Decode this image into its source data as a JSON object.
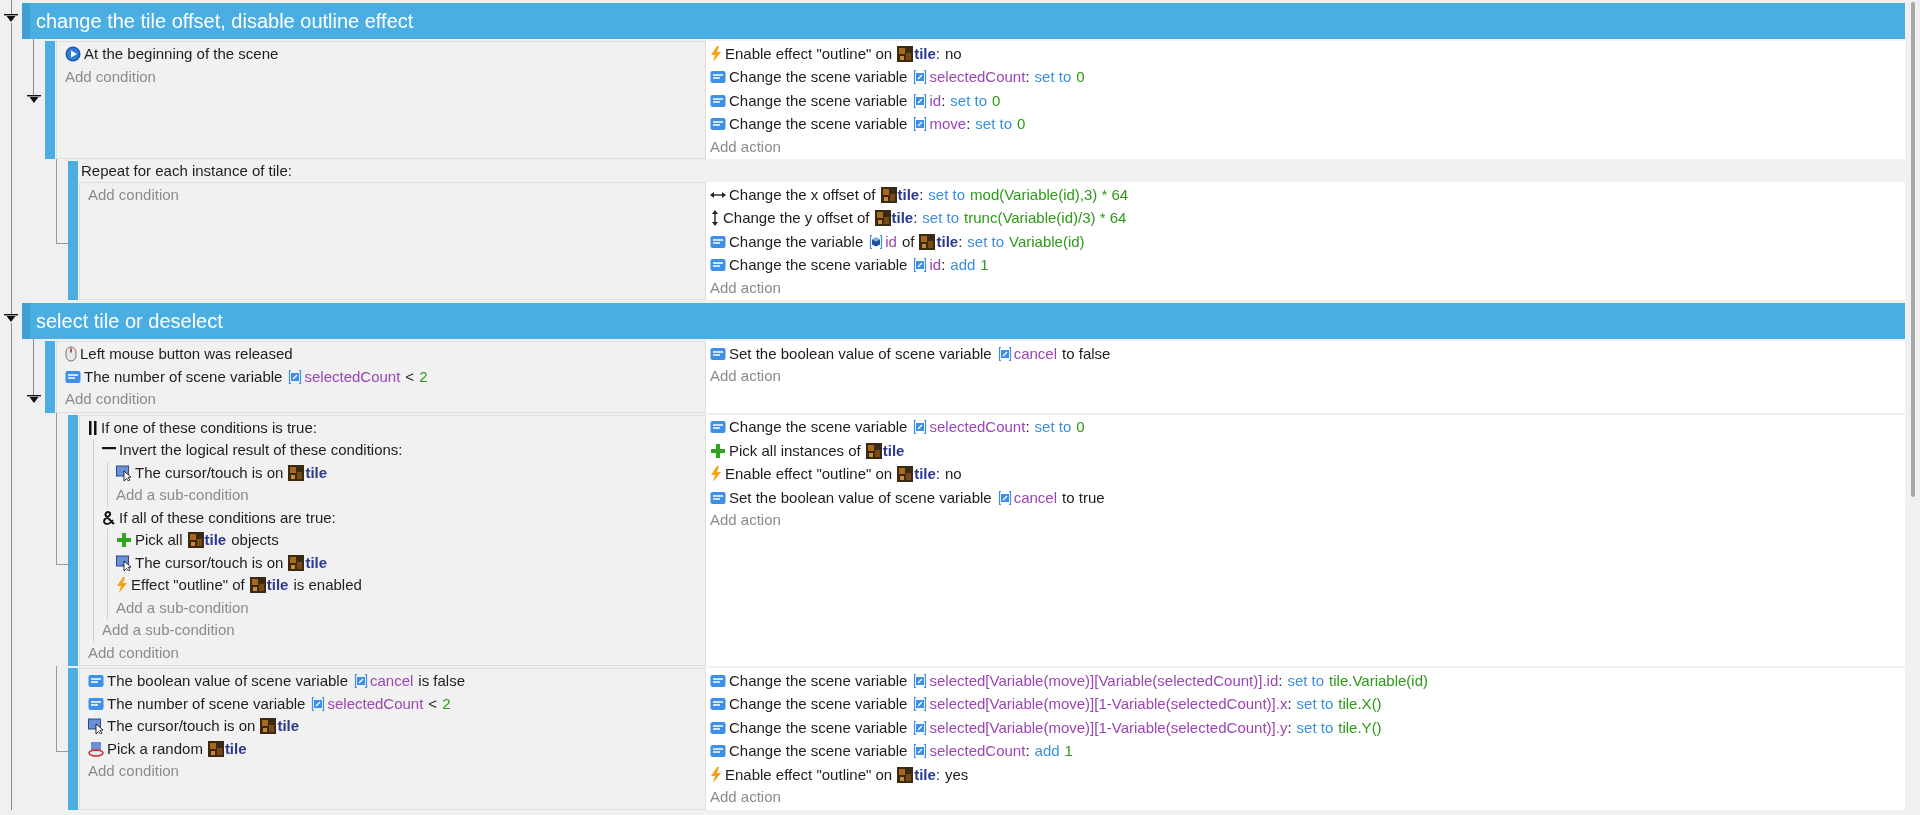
{
  "groups": [
    {
      "title": "change the tile offset, disable outline effect",
      "expanded": true,
      "events": [
        {
          "expanded": true,
          "conditions": [
            {
              "kind": "start",
              "parts": [
                {
                  "kind": "text",
                  "text": "At the beginning of the scene"
                }
              ]
            }
          ],
          "add_condition": "Add condition",
          "actions": [
            {
              "kind": "effect",
              "parts": [
                {
                  "kind": "text",
                  "text": "Enable effect \"outline\" on"
                },
                {
                  "kind": "object",
                  "text": "tile"
                },
                {
                  "kind": "punct",
                  "text": ":"
                },
                {
                  "kind": "text",
                  "text": "no"
                }
              ]
            },
            {
              "kind": "var",
              "parts": [
                {
                  "kind": "text",
                  "text": "Change the scene variable"
                },
                {
                  "kind": "scene_var",
                  "text": "selectedCount"
                },
                {
                  "kind": "punct",
                  "text": ":"
                },
                {
                  "kind": "operator",
                  "text": "set to"
                },
                {
                  "kind": "value",
                  "text": "0"
                }
              ]
            },
            {
              "kind": "var",
              "parts": [
                {
                  "kind": "text",
                  "text": "Change the scene variable"
                },
                {
                  "kind": "scene_var",
                  "text": "id"
                },
                {
                  "kind": "punct",
                  "text": ":"
                },
                {
                  "kind": "operator",
                  "text": "set to"
                },
                {
                  "kind": "value",
                  "text": "0"
                }
              ]
            },
            {
              "kind": "var",
              "parts": [
                {
                  "kind": "text",
                  "text": "Change the scene variable"
                },
                {
                  "kind": "scene_var",
                  "text": "move"
                },
                {
                  "kind": "punct",
                  "text": ":"
                },
                {
                  "kind": "operator",
                  "text": "set to"
                },
                {
                  "kind": "value",
                  "text": "0"
                }
              ]
            }
          ],
          "add_action": "Add action",
          "children": [
            {
              "header": "Repeat for each instance of tile:",
              "add_condition": "Add condition",
              "actions": [
                {
                  "kind": "offset_x",
                  "parts": [
                    {
                      "kind": "text",
                      "text": "Change the x offset of"
                    },
                    {
                      "kind": "object",
                      "text": "tile"
                    },
                    {
                      "kind": "punct",
                      "text": ":"
                    },
                    {
                      "kind": "operator",
                      "text": "set to"
                    },
                    {
                      "kind": "value",
                      "text": "mod(Variable(id),3) * 64"
                    }
                  ]
                },
                {
                  "kind": "offset_y",
                  "parts": [
                    {
                      "kind": "text",
                      "text": "Change the y offset of"
                    },
                    {
                      "kind": "object",
                      "text": "tile"
                    },
                    {
                      "kind": "punct",
                      "text": ":"
                    },
                    {
                      "kind": "operator",
                      "text": "set to"
                    },
                    {
                      "kind": "value",
                      "text": "trunc(Variable(id)/3) * 64"
                    }
                  ]
                },
                {
                  "kind": "var",
                  "parts": [
                    {
                      "kind": "text",
                      "text": "Change the variable"
                    },
                    {
                      "kind": "object_var",
                      "text": "id"
                    },
                    {
                      "kind": "text",
                      "text": "of"
                    },
                    {
                      "kind": "object",
                      "text": "tile"
                    },
                    {
                      "kind": "punct",
                      "text": ":"
                    },
                    {
                      "kind": "operator",
                      "text": "set to"
                    },
                    {
                      "kind": "value",
                      "text": "Variable(id)"
                    }
                  ]
                },
                {
                  "kind": "var",
                  "parts": [
                    {
                      "kind": "text",
                      "text": "Change the scene variable"
                    },
                    {
                      "kind": "scene_var",
                      "text": "id"
                    },
                    {
                      "kind": "punct",
                      "text": ":"
                    },
                    {
                      "kind": "operator",
                      "text": "add"
                    },
                    {
                      "kind": "value",
                      "text": "1"
                    }
                  ]
                }
              ],
              "add_action": "Add action"
            }
          ]
        }
      ]
    },
    {
      "title": "select tile or deselect",
      "expanded": true,
      "events": [
        {
          "expanded": true,
          "conditions": [
            {
              "kind": "mouse",
              "parts": [
                {
                  "kind": "text",
                  "text": "Left mouse button was released"
                }
              ]
            },
            {
              "kind": "var",
              "parts": [
                {
                  "kind": "text",
                  "text": "The number of scene variable"
                },
                {
                  "kind": "scene_var",
                  "text": "selectedCount"
                },
                {
                  "kind": "text",
                  "text": "<"
                },
                {
                  "kind": "value",
                  "text": "2"
                }
              ]
            }
          ],
          "add_condition": "Add condition",
          "actions": [
            {
              "kind": "var",
              "parts": [
                {
                  "kind": "text",
                  "text": "Set the boolean value of scene variable"
                },
                {
                  "kind": "scene_var",
                  "text": "cancel"
                },
                {
                  "kind": "text",
                  "text": "to false"
                }
              ]
            }
          ],
          "add_action": "Add action",
          "children": [
            {
              "conditions": [
                {
                  "kind": "or",
                  "parts": [
                    {
                      "kind": "text",
                      "text": "If one of these conditions is true:"
                    }
                  ],
                  "add_sub": "Add a sub-condition",
                  "children": [
                    {
                      "kind": "not",
                      "parts": [
                        {
                          "kind": "text",
                          "text": "Invert the logical result of these conditions:"
                        }
                      ],
                      "add_sub": "Add a sub-condition",
                      "children": [
                        {
                          "kind": "cursor",
                          "parts": [
                            {
                              "kind": "text",
                              "text": "The cursor/touch is on"
                            },
                            {
                              "kind": "object",
                              "text": "tile"
                            }
                          ]
                        }
                      ]
                    },
                    {
                      "kind": "and",
                      "parts": [
                        {
                          "kind": "text",
                          "text": "If all of these conditions are true:"
                        }
                      ],
                      "add_sub": "Add a sub-condition",
                      "children": [
                        {
                          "kind": "pick_all",
                          "parts": [
                            {
                              "kind": "text",
                              "text": "Pick all"
                            },
                            {
                              "kind": "object",
                              "text": "tile"
                            },
                            {
                              "kind": "text",
                              "text": "objects"
                            }
                          ]
                        },
                        {
                          "kind": "cursor",
                          "parts": [
                            {
                              "kind": "text",
                              "text": "The cursor/touch is on"
                            },
                            {
                              "kind": "object",
                              "text": "tile"
                            }
                          ]
                        },
                        {
                          "kind": "effect",
                          "parts": [
                            {
                              "kind": "text",
                              "text": "Effect \"outline\" of"
                            },
                            {
                              "kind": "object",
                              "text": "tile"
                            },
                            {
                              "kind": "text",
                              "text": "is enabled"
                            }
                          ]
                        }
                      ]
                    }
                  ]
                }
              ],
              "add_condition": "Add condition",
              "actions": [
                {
                  "kind": "var",
                  "parts": [
                    {
                      "kind": "text",
                      "text": "Change the scene variable"
                    },
                    {
                      "kind": "scene_var",
                      "text": "selectedCount"
                    },
                    {
                      "kind": "punct",
                      "text": ":"
                    },
                    {
                      "kind": "operator",
                      "text": "set to"
                    },
                    {
                      "kind": "value",
                      "text": "0"
                    }
                  ]
                },
                {
                  "kind": "pick_all",
                  "parts": [
                    {
                      "kind": "text",
                      "text": "Pick all instances of"
                    },
                    {
                      "kind": "object",
                      "text": "tile"
                    }
                  ]
                },
                {
                  "kind": "effect",
                  "parts": [
                    {
                      "kind": "text",
                      "text": "Enable effect \"outline\" on"
                    },
                    {
                      "kind": "object",
                      "text": "tile"
                    },
                    {
                      "kind": "punct",
                      "text": ":"
                    },
                    {
                      "kind": "text",
                      "text": "no"
                    }
                  ]
                },
                {
                  "kind": "var",
                  "parts": [
                    {
                      "kind": "text",
                      "text": "Set the boolean value of scene variable"
                    },
                    {
                      "kind": "scene_var",
                      "text": "cancel"
                    },
                    {
                      "kind": "text",
                      "text": "to true"
                    }
                  ]
                }
              ],
              "add_action": "Add action"
            },
            {
              "conditions": [
                {
                  "kind": "var",
                  "parts": [
                    {
                      "kind": "text",
                      "text": "The boolean value of scene variable"
                    },
                    {
                      "kind": "scene_var",
                      "text": "cancel"
                    },
                    {
                      "kind": "text",
                      "text": "is false"
                    }
                  ]
                },
                {
                  "kind": "var",
                  "parts": [
                    {
                      "kind": "text",
                      "text": "The number of scene variable"
                    },
                    {
                      "kind": "scene_var",
                      "text": "selectedCount"
                    },
                    {
                      "kind": "text",
                      "text": "<"
                    },
                    {
                      "kind": "value",
                      "text": "2"
                    }
                  ]
                },
                {
                  "kind": "cursor",
                  "parts": [
                    {
                      "kind": "text",
                      "text": "The cursor/touch is on"
                    },
                    {
                      "kind": "object",
                      "text": "tile"
                    }
                  ]
                },
                {
                  "kind": "random",
                  "parts": [
                    {
                      "kind": "text",
                      "text": "Pick a random"
                    },
                    {
                      "kind": "object",
                      "text": "tile"
                    }
                  ]
                }
              ],
              "add_condition": "Add condition",
              "actions": [
                {
                  "kind": "var",
                  "parts": [
                    {
                      "kind": "text",
                      "text": "Change the scene variable"
                    },
                    {
                      "kind": "scene_var",
                      "text": "selected[Variable(move)][Variable(selectedCount)].id"
                    },
                    {
                      "kind": "punct",
                      "text": ":"
                    },
                    {
                      "kind": "operator",
                      "text": "set to"
                    },
                    {
                      "kind": "value",
                      "text": "tile.Variable(id)"
                    }
                  ]
                },
                {
                  "kind": "var",
                  "parts": [
                    {
                      "kind": "text",
                      "text": "Change the scene variable"
                    },
                    {
                      "kind": "scene_var",
                      "text": "selected[Variable(move)][1-Variable(selectedCount)].x"
                    },
                    {
                      "kind": "punct",
                      "text": ":"
                    },
                    {
                      "kind": "operator",
                      "text": "set to"
                    },
                    {
                      "kind": "value",
                      "text": "tile.X()"
                    }
                  ]
                },
                {
                  "kind": "var",
                  "parts": [
                    {
                      "kind": "text",
                      "text": "Change the scene variable"
                    },
                    {
                      "kind": "scene_var",
                      "text": "selected[Variable(move)][1-Variable(selectedCount)].y"
                    },
                    {
                      "kind": "punct",
                      "text": ":"
                    },
                    {
                      "kind": "operator",
                      "text": "set to"
                    },
                    {
                      "kind": "value",
                      "text": "tile.Y()"
                    }
                  ]
                },
                {
                  "kind": "var",
                  "parts": [
                    {
                      "kind": "text",
                      "text": "Change the scene variable"
                    },
                    {
                      "kind": "scene_var",
                      "text": "selectedCount"
                    },
                    {
                      "kind": "punct",
                      "text": ":"
                    },
                    {
                      "kind": "operator",
                      "text": "add"
                    },
                    {
                      "kind": "value",
                      "text": "1"
                    }
                  ]
                },
                {
                  "kind": "effect",
                  "parts": [
                    {
                      "kind": "text",
                      "text": "Enable effect \"outline\" on"
                    },
                    {
                      "kind": "object",
                      "text": "tile"
                    },
                    {
                      "kind": "punct",
                      "text": ":"
                    },
                    {
                      "kind": "text",
                      "text": "yes"
                    }
                  ]
                }
              ],
              "add_action": "Add action"
            }
          ]
        }
      ]
    }
  ]
}
